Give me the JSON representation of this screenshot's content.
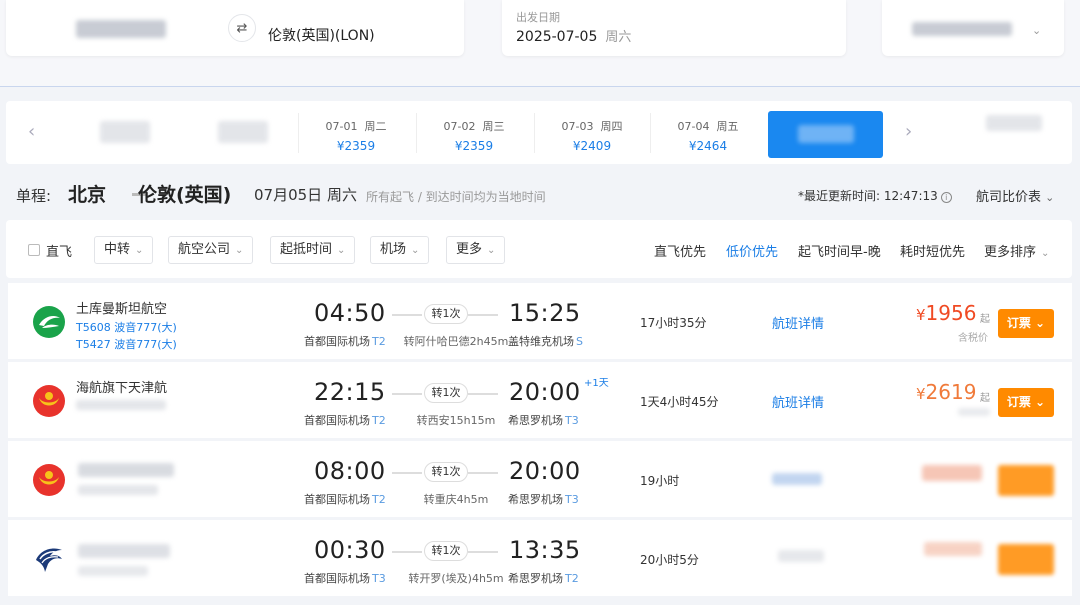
{
  "search": {
    "swap_icon": "⇄",
    "destination": "伦敦(英国)(LON)",
    "date_label": "出发日期",
    "date_value": "2025-07-05",
    "date_weekday": "周六",
    "chevron_icon": "⌄"
  },
  "date_strip": {
    "prev_icon": "‹",
    "next_icon": "›",
    "days": [
      {
        "date": "07-01",
        "weekday": "周二",
        "price": "¥2359"
      },
      {
        "date": "07-02",
        "weekday": "周三",
        "price": "¥2359"
      },
      {
        "date": "07-03",
        "weekday": "周四",
        "price": "¥2409"
      },
      {
        "date": "07-04",
        "weekday": "周五",
        "price": "¥2464"
      }
    ]
  },
  "route": {
    "label": "单程:",
    "from": "北京",
    "to": "伦敦(英国)",
    "date": "07月05日 周六",
    "note": "所有起飞 / 到达时间均为当地时间",
    "update_label": "*最近更新时间: 12:47:13",
    "info_icon": "i",
    "compare": "航司比价表",
    "compare_chevron": "⌄"
  },
  "filters": {
    "direct": "直飞",
    "buttons": [
      "中转",
      "航空公司",
      "起抵时间",
      "机场",
      "更多"
    ],
    "caret": "⌄",
    "sorts": [
      "直飞优先",
      "低价优先",
      "起飞时间早-晚",
      "耗时短优先",
      "更多排序"
    ],
    "active_sort": "低价优先",
    "more_sort_caret": "⌄"
  },
  "flights": [
    {
      "airline": "土库曼斯坦航空",
      "plane1": "T5608 波音777(大)",
      "plane2": "T5427 波音777(大)",
      "dep_time": "04:50",
      "dep_airport": "首都国际机场",
      "dep_terminal": "T2",
      "transfer": "转1次",
      "transfer_city": "转阿什哈巴德2h45m",
      "arr_time": "15:25",
      "arr_airport": "盖特维克机场",
      "arr_terminal": "S",
      "plus_day": "",
      "duration": "17小时35分",
      "detail": "航班详情",
      "price": "1956",
      "price_currency": "¥",
      "price_suffix": "起",
      "price_tax": "含税价",
      "book": "订票 ⌄",
      "blurred": false
    },
    {
      "airline": "海航旗下天津航",
      "plane1": "",
      "plane2": "",
      "dep_time": "22:15",
      "dep_airport": "首都国际机场",
      "dep_terminal": "T2",
      "transfer": "转1次",
      "transfer_city": "转西安15h15m",
      "arr_time": "20:00",
      "arr_airport": "希思罗机场",
      "arr_terminal": "T3",
      "plus_day": "+1天",
      "duration": "1天4小时45分",
      "detail": "航班详情",
      "price": "2619",
      "price_currency": "¥",
      "price_suffix": "起",
      "price_tax": "",
      "book": "订票 ⌄",
      "blurred": false
    },
    {
      "airline": "",
      "plane1": "",
      "plane2": "",
      "dep_time": "08:00",
      "dep_airport": "首都国际机场",
      "dep_terminal": "T2",
      "transfer": "转1次",
      "transfer_city": "转重庆4h5m",
      "arr_time": "20:00",
      "arr_airport": "希思罗机场",
      "arr_terminal": "T3",
      "plus_day": "",
      "duration": "19小时",
      "detail": "",
      "price": "",
      "price_currency": "",
      "price_suffix": "",
      "price_tax": "",
      "book": "",
      "blurred": true
    },
    {
      "airline": "",
      "plane1": "",
      "plane2": "",
      "dep_time": "00:30",
      "dep_airport": "首都国际机场",
      "dep_terminal": "T3",
      "transfer": "转1次",
      "transfer_city": "转开罗(埃及)4h5m",
      "arr_time": "13:35",
      "arr_airport": "希思罗机场",
      "arr_terminal": "T2",
      "plus_day": "",
      "duration": "20小时5分",
      "detail": "",
      "price": "",
      "price_currency": "",
      "price_suffix": "",
      "price_tax": "",
      "book": "",
      "blurred": true
    }
  ],
  "colors": {
    "accent": "#1b7ee6",
    "price": "#f04a23",
    "book": "#ff8a00",
    "active_date": "#1a88f0",
    "logo_green": "#1aa34a",
    "logo_red": "#e8332c",
    "logo_yellow": "#f7c31a",
    "logo_navy": "#1c3a78"
  }
}
